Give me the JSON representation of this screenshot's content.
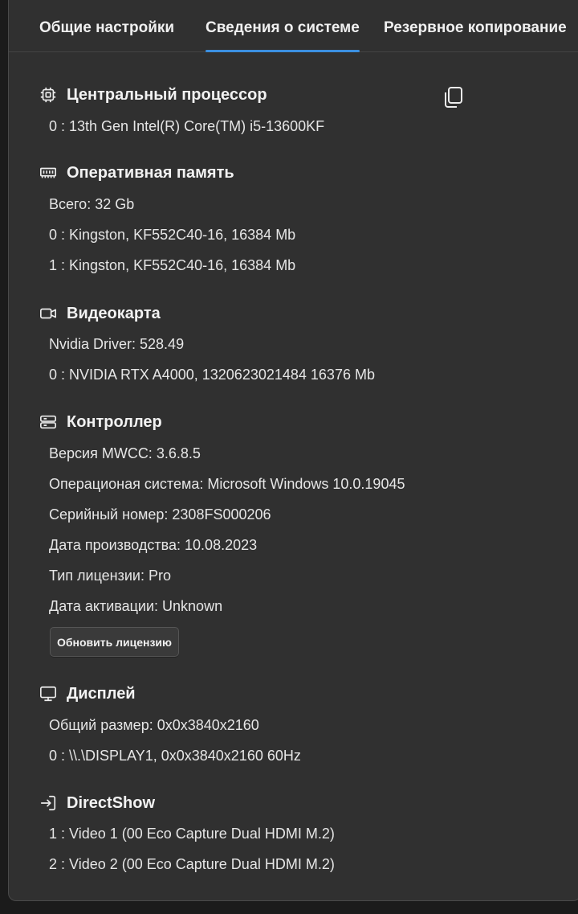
{
  "tabs": [
    {
      "label": "Общие настройки"
    },
    {
      "label": "Сведения о системе"
    },
    {
      "label": "Резервное копирование"
    }
  ],
  "cpu": {
    "title": "Центральный процессор",
    "icon": "cpu-icon",
    "lines": [
      "0 : 13th Gen Intel(R) Core(TM) i5-13600KF"
    ]
  },
  "ram": {
    "title": "Оперативная память",
    "icon": "ram-icon",
    "lines": [
      "Всего: 32 Gb",
      "0 : Kingston, KF552C40-16, 16384 Mb",
      "1 : Kingston, KF552C40-16, 16384 Mb"
    ]
  },
  "gpu": {
    "title": "Видеокарта",
    "icon": "video-camera-icon",
    "lines": [
      "Nvidia Driver: 528.49",
      "0 : NVIDIA RTX A4000, 1320623021484 16376 Mb"
    ]
  },
  "controller": {
    "title": "Контроллер",
    "icon": "server-icon",
    "lines": [
      "Версия MWCC: 3.6.8.5",
      "Операционая система: Microsoft Windows 10.0.19045",
      "Серийный номер: 2308FS000206",
      "Дата производства: 10.08.2023",
      "Тип лицензии: Pro",
      "Дата активации: Unknown"
    ],
    "button_label": "Обновить лицензию"
  },
  "display": {
    "title": "Дисплей",
    "icon": "monitor-icon",
    "lines": [
      "Общий размер: 0x0x3840x2160",
      "0 : \\\\.\\DISPLAY1, 0x0x3840x2160 60Hz"
    ]
  },
  "directshow": {
    "title": "DirectShow",
    "icon": "sign-in-icon",
    "lines": [
      "1 : Video 1 (00 Eco Capture Dual HDMI M.2)",
      "2 : Video 2 (00 Eco Capture Dual HDMI M.2)"
    ]
  },
  "copy_icon": "copy-icon",
  "colors": {
    "background": "#303030",
    "accent": "#3b8fe0",
    "text": "#ececec"
  }
}
